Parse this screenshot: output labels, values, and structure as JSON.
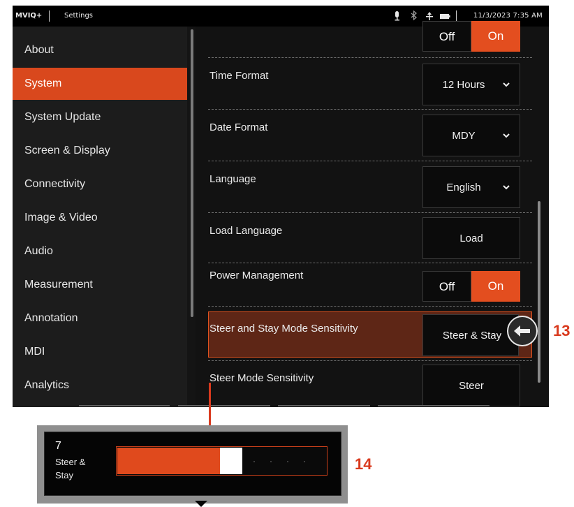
{
  "statusbar": {
    "brand": "MVIQ+",
    "title": "Settings",
    "datetime": "11/3/2023 7:35 AM",
    "icons": [
      "microphone-icon",
      "bluetooth-icon",
      "wifi-icon",
      "battery-icon"
    ]
  },
  "sidebar": {
    "items": [
      {
        "label": "About"
      },
      {
        "label": "System"
      },
      {
        "label": "System Update"
      },
      {
        "label": "Screen & Display"
      },
      {
        "label": "Connectivity"
      },
      {
        "label": "Image & Video"
      },
      {
        "label": "Audio"
      },
      {
        "label": "Measurement"
      },
      {
        "label": "Annotation"
      },
      {
        "label": "MDI"
      },
      {
        "label": "Analytics"
      }
    ],
    "active": "System"
  },
  "settings": {
    "top_toggle": {
      "off": "Off",
      "on": "On"
    },
    "time_format": {
      "label": "Time Format",
      "value": "12 Hours"
    },
    "date_format": {
      "label": "Date Format",
      "value": "MDY"
    },
    "language": {
      "label": "Language",
      "value": "English"
    },
    "load_language": {
      "label": "Load Language",
      "button": "Load"
    },
    "power_management": {
      "label": "Power Management",
      "off": "Off",
      "on": "On"
    },
    "steer_stay": {
      "label": "Steer and Stay Mode Sensitivity",
      "value": "Steer & Stay"
    },
    "steer_mode": {
      "label": "Steer Mode Sensitivity",
      "value": "Steer"
    }
  },
  "callouts": {
    "c13": "13",
    "c14": "14"
  },
  "popup": {
    "value": "7",
    "label": "Steer & Stay",
    "level_fraction": 0.55
  },
  "colors": {
    "accent": "#d9481d",
    "callout": "#d93a1e"
  }
}
